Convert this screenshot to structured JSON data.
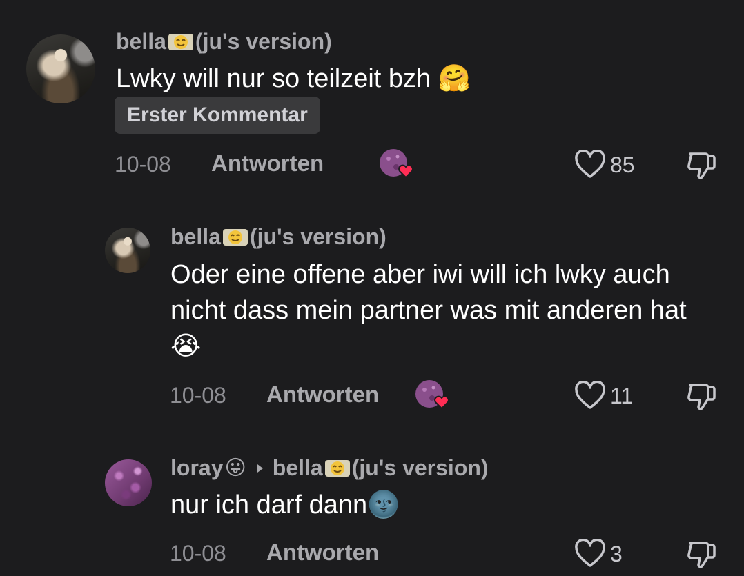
{
  "comments": [
    {
      "username": "bella",
      "username_suffix": "(ju's version)",
      "badge_icon": "smiling-face-emoji",
      "text": "Lwky will nur so teilzeit bzh 🤗",
      "tag": "Erster Kommentar",
      "date": "10-08",
      "reply_label": "Antworten",
      "likes": "85",
      "creator_liked": true
    },
    {
      "username": "bella",
      "username_suffix": "(ju's version)",
      "badge_icon": "smiling-face-emoji",
      "text": "Oder eine offene aber iwi will ich lwky auch nicht dass mein partner was mit anderen hat 😭",
      "date": "10-08",
      "reply_label": "Antworten",
      "likes": "11",
      "creator_liked": true
    },
    {
      "username": "loray",
      "user_emoji": "😛",
      "reply_to": "bella",
      "reply_to_suffix": "(ju's version)",
      "text": "nur ich darf dann🌚",
      "date": "10-08",
      "reply_label": "Antworten",
      "likes": "3",
      "creator_liked": false
    }
  ],
  "colors": {
    "background": "#1c1c1e",
    "username": "#a9a9ad",
    "meta": "#8e8e93",
    "heart_badge": "#ff2d55"
  }
}
